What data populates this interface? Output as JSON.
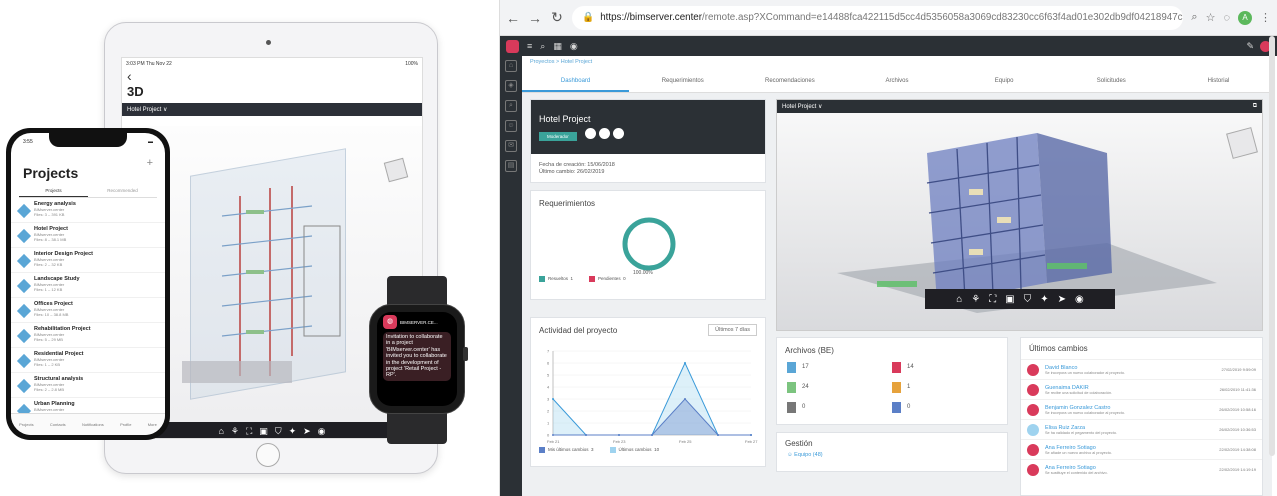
{
  "ipad": {
    "time": "3:03 PM Thu Nov 22",
    "status_right": "100%",
    "title": "3D",
    "project_bar": "Hotel Project ∨"
  },
  "iphone": {
    "time": "3:55",
    "title": "Projects",
    "tabs": [
      "Projects",
      "Recommended"
    ],
    "projects": [
      {
        "name": "Energy analysis",
        "owner": "BIMserver.center",
        "files": "Files: 3 – 391 KB"
      },
      {
        "name": "Hotel Project",
        "owner": "BIMserver.center",
        "files": "Files: 8 – 38.1 MB"
      },
      {
        "name": "Interior Design Project",
        "owner": "BIMserver.center",
        "files": "Files: 2 – 32 KB"
      },
      {
        "name": "Landscape Study",
        "owner": "BIMserver.center",
        "files": "Files: 1 – 12 KB"
      },
      {
        "name": "Offices Project",
        "owner": "BIMserver.center",
        "files": "Files: 10 – 38.8 MB"
      },
      {
        "name": "Rehabilitation Project",
        "owner": "BIMserver.center",
        "files": "Files: 5 – 29 MB"
      },
      {
        "name": "Residential Project",
        "owner": "BIMserver.center",
        "files": "Files: 1 – 2 KB"
      },
      {
        "name": "Structural analysis",
        "owner": "BIMserver.center",
        "files": "Files: 2 – 2.8 MB"
      },
      {
        "name": "Urban Planning",
        "owner": "BIMserver.center",
        "files": ""
      }
    ],
    "nav": [
      "Projects",
      "Contacts",
      "Notifications",
      "Profile",
      "More"
    ]
  },
  "watch": {
    "app": "BIMSERVER.CE...",
    "message": "Invitation to collaborate in a project 'BIMserver.center' has invited you to collaborate in the development of project 'Retail Project - RP'."
  },
  "browser": {
    "url_host": "https://bimserver.center",
    "url_rest": "/remote.asp?XCommand=e14488fca422115d5cc4d5356058a3069cd83230cc6f63f4ad01e302db9df04218947c9b5f96adea8a1041e..."
  },
  "app": {
    "breadcrumb": "Proyectos  >  Hotel Project",
    "tabs": [
      "Dashboard",
      "Requerimientos",
      "Recomendaciones",
      "Archivos",
      "Equipo",
      "Solicitudes",
      "Historial"
    ],
    "project": {
      "title": "Hotel Project",
      "badge": "Moderador",
      "created": "Fecha de creación: 15/06/2018",
      "changed": "Último cambio: 26/02/2019"
    },
    "requirements": {
      "title": "Requerimientos",
      "percent": "100.00%",
      "legend": [
        {
          "label": "Resueltos",
          "value": "1",
          "color": "#3aa39a"
        },
        {
          "label": "Pendientes",
          "value": "0",
          "color": "#d93a5b"
        }
      ]
    },
    "viewer": {
      "title": "Hotel Project ∨"
    },
    "activity": {
      "title": "Actividad del proyecto",
      "range": "Últimos 7 días",
      "legend": [
        {
          "label": "Mis últimos cambios",
          "value": "3",
          "color": "#5b7fc7"
        },
        {
          "label": "Últimos cambios",
          "value": "10",
          "color": "#9fd3ef"
        }
      ]
    },
    "files": {
      "title": "Archivos (BE)",
      "items": [
        {
          "count": "17",
          "color": "#5aa6d6"
        },
        {
          "count": "14",
          "color": "#d93a5b"
        },
        {
          "count": "24",
          "color": "#7cc47f"
        },
        {
          "count": "1",
          "color": "#e6a23c"
        },
        {
          "count": "0",
          "color": "#777"
        },
        {
          "count": "0",
          "color": "#5b7fc7"
        }
      ]
    },
    "management": {
      "title": "Gestión",
      "link": "Equipo (48)"
    },
    "changes": {
      "title": "Últimos cambios",
      "items": [
        {
          "name": "David Blanco",
          "desc": "Se incorpora un nuevo colaborador al proyecto.",
          "date": "27/02/2019 9:59:09"
        },
        {
          "name": "Guenaima DAKIR",
          "desc": "Se recibe una solicitud de colaboración.",
          "date": "26/02/2019 11:41:36"
        },
        {
          "name": "Benjamin Gonzalez Castro",
          "desc": "Se incorpora un nuevo colaborador al proyecto.",
          "date": "26/02/2019 10:58:16"
        },
        {
          "name": "Elisa Ruiz Zarza",
          "desc": "Se ha validado el pegamento del proyecto.",
          "date": "26/02/2019 10:36:53"
        },
        {
          "name": "Ana Ferreiro Sotiago",
          "desc": "Se añade un nuevo archivo al proyecto.",
          "date": "22/02/2019 14:38:08"
        },
        {
          "name": "Ana Ferreiro Sotiago",
          "desc": "Se sustituye el contenido del archivo.",
          "date": "22/02/2019 14:19:19"
        }
      ]
    }
  },
  "chart_data": {
    "type": "area",
    "categories": [
      "Feb 21",
      "Feb 23",
      "Feb 25",
      "Feb 27"
    ],
    "ylim": [
      0,
      7
    ],
    "y_ticks": [
      "0",
      "1",
      "2",
      "3",
      "4",
      "5",
      "6",
      "7"
    ],
    "series": [
      {
        "name": "Mis últimos cambios",
        "x": [
          0,
          1,
          2,
          3,
          4,
          5,
          6
        ],
        "values": [
          0,
          0,
          0,
          0,
          3,
          0,
          0
        ]
      },
      {
        "name": "Últimos cambios",
        "x": [
          0,
          1,
          2,
          3,
          4,
          5,
          6
        ],
        "values": [
          3,
          0,
          0,
          0,
          6,
          0,
          0
        ]
      }
    ]
  }
}
